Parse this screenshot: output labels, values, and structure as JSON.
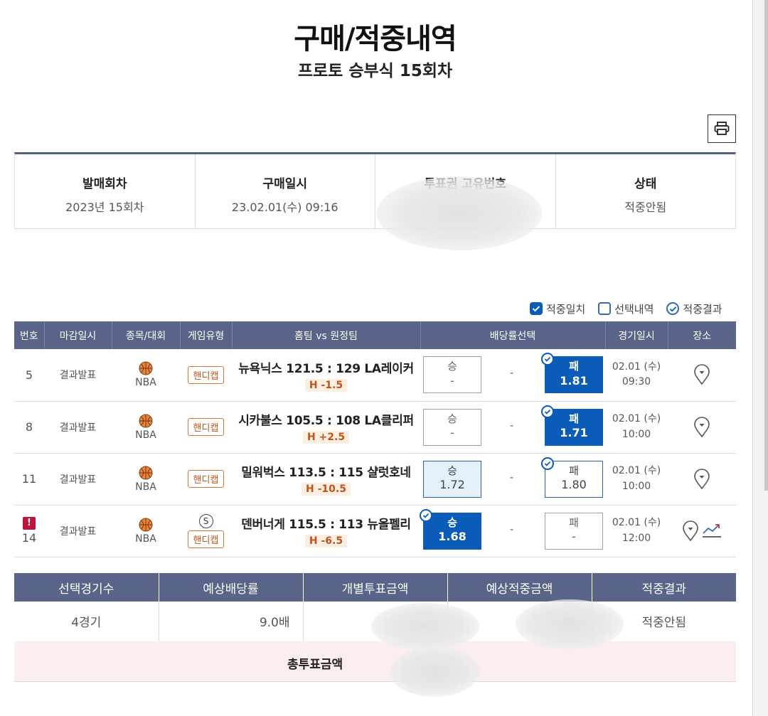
{
  "page": {
    "title": "구매/적중내역",
    "subtitle": "프로토 승부식 15회차"
  },
  "info": [
    {
      "label": "발매회차",
      "value": "2023년 15회차"
    },
    {
      "label": "구매일시",
      "value": "23.02.01(수) 09:16"
    },
    {
      "label": "투표권 고유번호",
      "value": ""
    },
    {
      "label": "상태",
      "value": "적중안됨"
    }
  ],
  "legend": {
    "match": "적중일치",
    "selection": "선택내역",
    "result": "적중결과"
  },
  "table": {
    "headers": [
      "번호",
      "마감일시",
      "종목/대회",
      "게임유형",
      "홈팀 vs 원정팀",
      "배당률선택",
      "경기일시",
      "장소"
    ],
    "rows": [
      {
        "no": "5",
        "deadline": "결과발표",
        "sport": "NBA",
        "type": "핸디캡",
        "match": "뉴욕닉스 121.5 : 129 LA레이커",
        "handicap": "H -1.5",
        "win_label": "승",
        "win_odds": "-",
        "draw": "-",
        "lose_label": "패",
        "lose_odds": "1.81",
        "date": "02.01 (수)",
        "time": "09:30"
      },
      {
        "no": "8",
        "deadline": "결과발표",
        "sport": "NBA",
        "type": "핸디캡",
        "match": "시카불스 105.5 : 108 LA클리퍼",
        "handicap": "H +2.5",
        "win_label": "승",
        "win_odds": "-",
        "draw": "-",
        "lose_label": "패",
        "lose_odds": "1.71",
        "date": "02.01 (수)",
        "time": "10:00"
      },
      {
        "no": "11",
        "deadline": "결과발표",
        "sport": "NBA",
        "type": "핸디캡",
        "match": "밀워벅스 113.5 : 115 샬럿호네",
        "handicap": "H -10.5",
        "win_label": "승",
        "win_odds": "1.72",
        "draw": "-",
        "lose_label": "패",
        "lose_odds": "1.80",
        "date": "02.01 (수)",
        "time": "10:00"
      },
      {
        "no": "14",
        "warning": "!",
        "deadline": "결과발표",
        "sport": "NBA",
        "special": "S",
        "type": "핸디캡",
        "match": "덴버너게 115.5 : 113 뉴올펠리",
        "handicap": "H -6.5",
        "win_label": "승",
        "win_odds": "1.68",
        "draw": "-",
        "lose_label": "패",
        "lose_odds": "-",
        "date": "02.01 (수)",
        "time": "12:00"
      }
    ]
  },
  "summary": {
    "headers": [
      "선택경기수",
      "예상배당률",
      "개별투표금액",
      "예상적중금액",
      "적중결과"
    ],
    "values": [
      "4경기",
      "9.0배",
      "",
      "",
      "적중안됨"
    ],
    "total_label": "총투표금액"
  },
  "colors": {
    "header_bg": "#5a6488",
    "selected_blue": "#0a5cb8",
    "handicap_orange": "#c0541b",
    "warning_red": "#c0143c",
    "total_row_bg": "#fbeeee"
  },
  "icons": [
    "print-icon",
    "basketball-icon",
    "location-pin-icon",
    "trend-chart-icon",
    "check-icon",
    "warning-icon"
  ]
}
